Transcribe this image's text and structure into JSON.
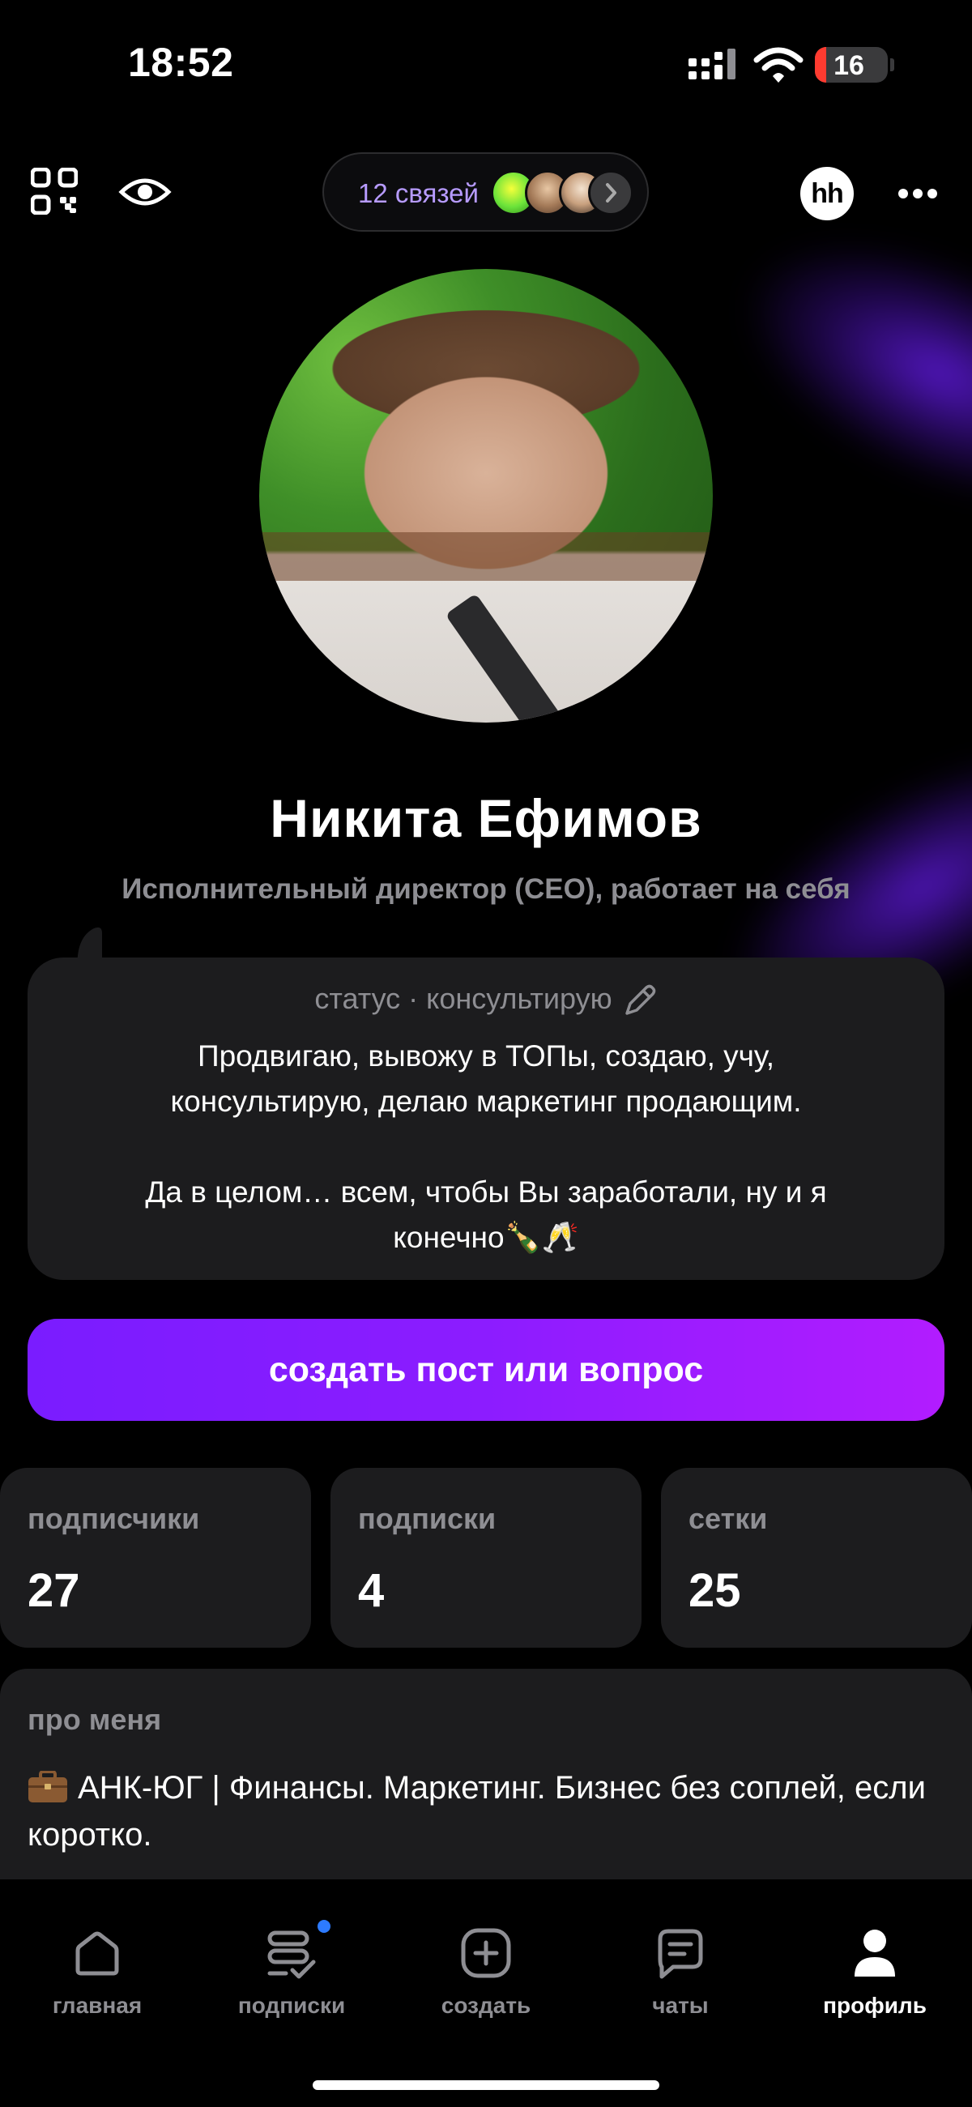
{
  "status_bar": {
    "time": "18:52",
    "battery": "16"
  },
  "header": {
    "connections_label": "12 связей",
    "hh_logo": "hh"
  },
  "profile": {
    "name": "Никита Ефимов",
    "job": "Исполнительный директор (CEO), работает на себя"
  },
  "status": {
    "header": "статус · консультирую",
    "text_line1": "Продвигаю, вывожу в ТОПы, создаю, учу,",
    "text_line2": "консультирую, делаю маркетинг продающим.",
    "text_line3": "Да в целом… всем, чтобы Вы заработали, ну и я",
    "text_line4": "конечно🍾🥂"
  },
  "create_button": "создать пост или вопрос",
  "stats": [
    {
      "label": "подписчики",
      "value": "27"
    },
    {
      "label": "подписки",
      "value": "4"
    },
    {
      "label": "сетки",
      "value": "25"
    }
  ],
  "about": {
    "title": "про меня",
    "text": "АНК-ЮГ | Финансы. Маркетинг. Бизнес без соплей, если коротко."
  },
  "tabs": [
    {
      "label": "главная",
      "icon": "home-icon"
    },
    {
      "label": "подписки",
      "icon": "subscriptions-icon"
    },
    {
      "label": "создать",
      "icon": "plus-square-icon"
    },
    {
      "label": "чаты",
      "icon": "chat-icon"
    },
    {
      "label": "профиль",
      "icon": "person-icon"
    }
  ],
  "colors": {
    "accent": "#8c1cff",
    "card": "#1c1c1e",
    "muted": "#8e8e93",
    "badge": "#2d7bff"
  }
}
